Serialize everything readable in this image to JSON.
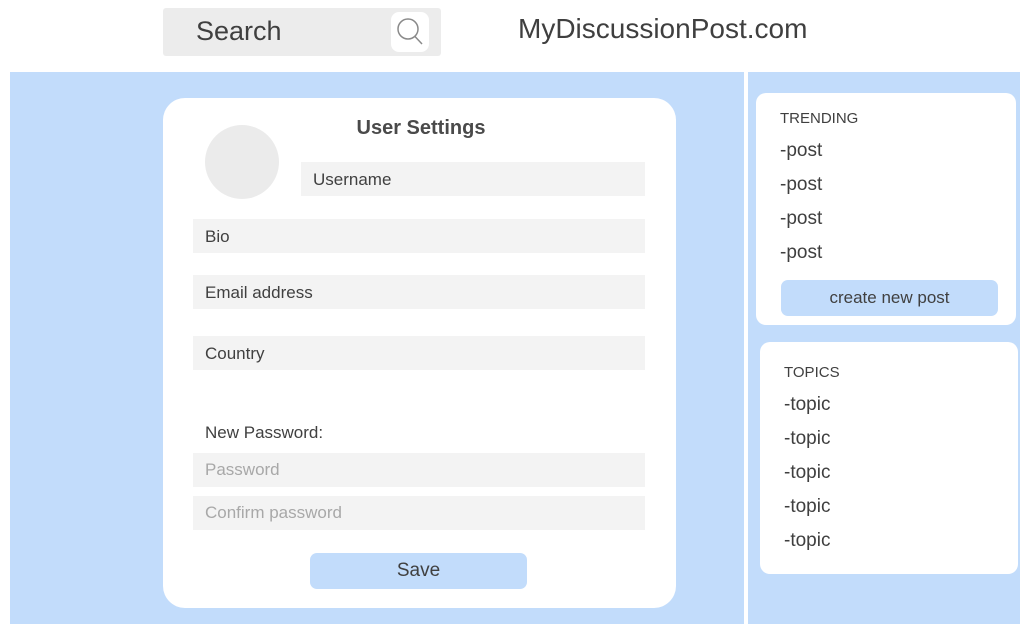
{
  "header": {
    "search_label": "Search",
    "site_title": "MyDiscussionPost.com"
  },
  "settings": {
    "title": "User Settings",
    "username_label": "Username",
    "bio_label": "Bio",
    "email_label": "Email address",
    "country_label": "Country",
    "new_password_label": "New Password:",
    "password_placeholder": "Password",
    "confirm_password_placeholder": "Confirm password",
    "save_label": "Save"
  },
  "trending": {
    "heading": "TRENDING",
    "items": [
      "-post",
      "-post",
      "-post",
      "-post"
    ],
    "create_label": "create new post"
  },
  "topics": {
    "heading": "TOPICS",
    "items": [
      "-topic",
      "-topic",
      "-topic",
      "-topic",
      "-topic"
    ]
  },
  "colors": {
    "accent_blue": "#c2dcfb",
    "field_gray": "#f3f3f3"
  }
}
